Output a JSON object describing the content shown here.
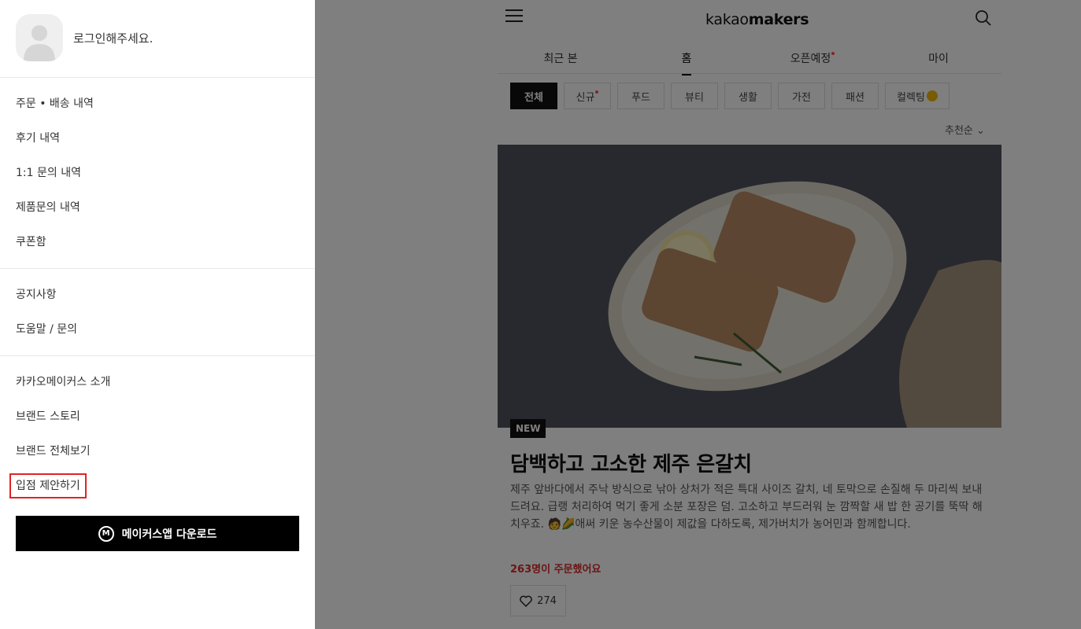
{
  "drawer": {
    "login_prompt": "로그인해주세요.",
    "menu_groups": [
      {
        "items": [
          "주문 • 배송 내역",
          "후기 내역",
          "1:1 문의 내역",
          "제품문의 내역",
          "쿠폰함"
        ]
      },
      {
        "items": [
          "공지사항",
          "도움말 / 문의"
        ]
      },
      {
        "items": [
          "카카오메이커스 소개",
          "브랜드 스토리",
          "브랜드 전체보기",
          "입점 제안하기"
        ]
      }
    ],
    "app_download_label": "메이커스앱 다운로드",
    "app_logo_letter": "M"
  },
  "header": {
    "logo_light": "kakao",
    "logo_bold": "makers",
    "icons": {
      "menu": "hamburger-icon",
      "search": "search-icon"
    }
  },
  "tabs": [
    {
      "label": "최근 본",
      "active": false,
      "new_dot": false
    },
    {
      "label": "홈",
      "active": true,
      "new_dot": false
    },
    {
      "label": "오픈예정",
      "active": false,
      "new_dot": true
    },
    {
      "label": "마이",
      "active": false,
      "new_dot": false
    }
  ],
  "categories": [
    {
      "label": "전체",
      "active": true,
      "new_dot": false
    },
    {
      "label": "신규",
      "active": false,
      "new_dot": true
    },
    {
      "label": "푸드",
      "active": false,
      "new_dot": false
    },
    {
      "label": "뷰티",
      "active": false,
      "new_dot": false
    },
    {
      "label": "생활",
      "active": false,
      "new_dot": false
    },
    {
      "label": "가전",
      "active": false,
      "new_dot": false
    },
    {
      "label": "패션",
      "active": false,
      "new_dot": false
    },
    {
      "label": "컬렉팅",
      "active": false,
      "new_dot": false
    }
  ],
  "sort_label": "추천순",
  "product": {
    "badge": "NEW",
    "title": "담백하고 고소한 제주 은갈치",
    "description": "제주 앞바다에서 주낙 방식으로 낚아 상처가 적은 특대 사이즈 갈치, 네 토막으로 손질해 두 마리씩 보내드려요. 급랭 처리하여 먹기 좋게 소분 포장은 덤. 고소하고 부드러워 눈 깜짝할 새 밥 한 공기를 뚝딱 해치우죠. 🧑🌽애써 키운 농수산물이 제값을 다하도록, 제가버치가 농어민과 함께합니다.",
    "order_count": "263명이 주문했어요",
    "like_count": "274"
  },
  "colors": {
    "accent_red": "#d92b2b",
    "highlight_border": "#e02424",
    "overlay": "rgba(0,0,0,0.5)"
  }
}
